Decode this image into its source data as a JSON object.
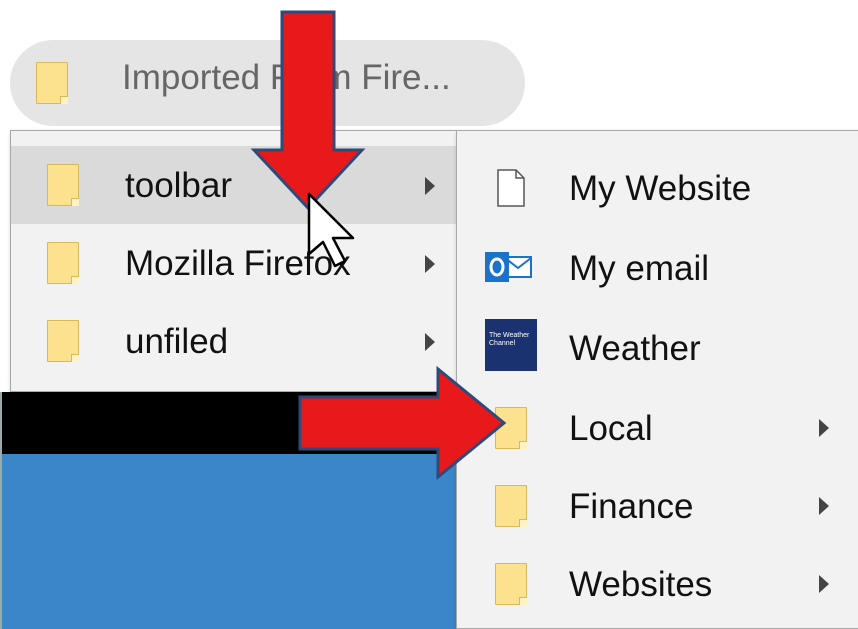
{
  "toolbar": {
    "folder_label": "Imported From Fire..."
  },
  "folder_menu": {
    "items": [
      {
        "label": "toolbar",
        "icon": "folder-icon",
        "has_submenu": true,
        "hovered": true
      },
      {
        "label": "Mozilla Firefox",
        "icon": "folder-icon",
        "has_submenu": true
      },
      {
        "label": "unfiled",
        "icon": "folder-icon",
        "has_submenu": true
      }
    ]
  },
  "toolbar_submenu": {
    "items": [
      {
        "label": "My Website",
        "icon": "page-icon",
        "has_submenu": false
      },
      {
        "label": "My email",
        "icon": "outlook-icon",
        "has_submenu": false
      },
      {
        "label": "Weather",
        "icon": "weather-channel-icon",
        "icon_text": "The Weather Channel",
        "has_submenu": false
      },
      {
        "label": "Local",
        "icon": "folder-icon",
        "has_submenu": true
      },
      {
        "label": "Finance",
        "icon": "folder-icon",
        "has_submenu": true
      },
      {
        "label": "Websites",
        "icon": "folder-icon",
        "has_submenu": true
      }
    ]
  },
  "annotations": {
    "arrow_color": "#e8191b",
    "arrow_outline": "#2e4a7a"
  }
}
